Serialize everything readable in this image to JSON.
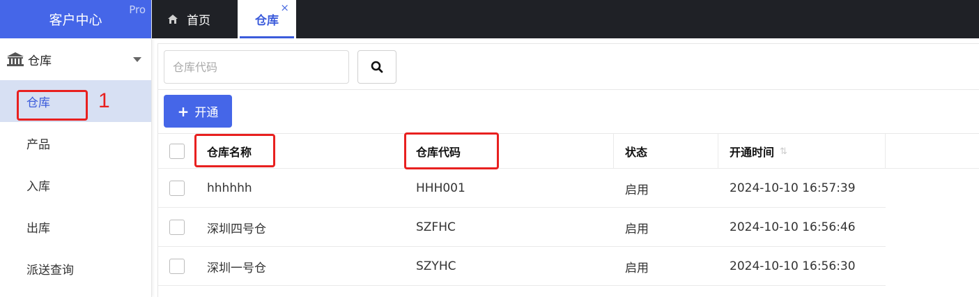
{
  "app": {
    "title": "客户中心",
    "badge": "Pro"
  },
  "colors": {
    "brand": "#4566e8",
    "topbar": "#1f2126",
    "active_menu_bg": "#d7e0f3",
    "annotation": "#e8201f"
  },
  "sidebar": {
    "group": {
      "icon": "bank-icon",
      "label": "仓库",
      "caret_icon": "caret-down-icon"
    },
    "items": [
      {
        "label": "仓库",
        "active": true
      },
      {
        "label": "产品",
        "active": false
      },
      {
        "label": "入库",
        "active": false
      },
      {
        "label": "出库",
        "active": false
      },
      {
        "label": "派送查询",
        "active": false
      }
    ]
  },
  "tabs": [
    {
      "label": "首页",
      "icon": "home-icon",
      "active": false
    },
    {
      "label": "仓库",
      "active": true,
      "close_icon": "×"
    }
  ],
  "toolbar": {
    "search_placeholder": "仓库代码",
    "search_icon": "search-icon",
    "open_button": {
      "icon": "+",
      "label": "开通"
    }
  },
  "table": {
    "columns": [
      {
        "label": "仓库名称"
      },
      {
        "label": "仓库代码"
      },
      {
        "label": "状态"
      },
      {
        "label": "开通时间",
        "sort_icon": "⇅"
      }
    ],
    "rows": [
      {
        "name": "hhhhhh",
        "code": "HHH001",
        "status": "启用",
        "time": "2024-10-10 16:57:39"
      },
      {
        "name": "深圳四号仓",
        "code": "SZFHC",
        "status": "启用",
        "time": "2024-10-10 16:56:46"
      },
      {
        "name": "深圳一号仓",
        "code": "SZYHC",
        "status": "启用",
        "time": "2024-10-10 16:56:30"
      }
    ]
  },
  "annotations": {
    "marker_number": "1"
  }
}
